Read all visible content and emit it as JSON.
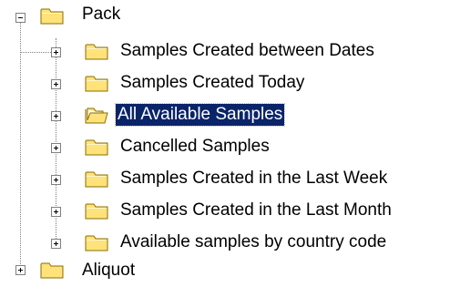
{
  "tree": {
    "root": {
      "label": "Pack",
      "expanded": true
    },
    "children": [
      {
        "label": "Samples Created between Dates",
        "selected": false
      },
      {
        "label": "Samples Created Today",
        "selected": false
      },
      {
        "label": "All Available Samples",
        "selected": true
      },
      {
        "label": "Cancelled Samples",
        "selected": false
      },
      {
        "label": "Samples Created in the Last Week",
        "selected": false
      },
      {
        "label": "Samples Created in the Last Month",
        "selected": false
      },
      {
        "label": "Available samples by country code",
        "selected": false
      }
    ],
    "next_sibling": {
      "label": "Aliquot"
    }
  },
  "colors": {
    "folder_fill": "#ffe27a",
    "folder_outline": "#8a6d00",
    "selection": "#0a246a",
    "tree_lines": "#808080"
  }
}
